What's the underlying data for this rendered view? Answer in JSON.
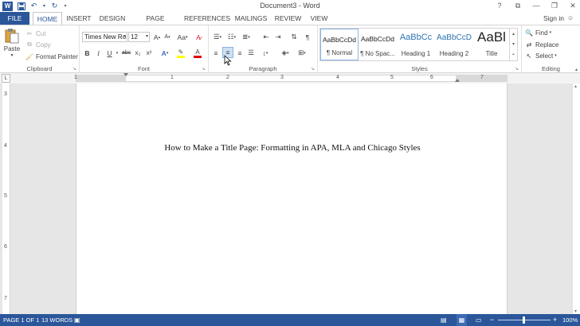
{
  "titlebar": {
    "app_icon": "W",
    "title": "Document3 - Word",
    "help": "?",
    "ribbon_display": "⧉",
    "minimize": "—",
    "restore": "❐",
    "close": "✕"
  },
  "tabs": {
    "file": "FILE",
    "items": [
      "HOME",
      "INSERT",
      "DESIGN",
      "PAGE LAYOUT",
      "REFERENCES",
      "MAILINGS",
      "REVIEW",
      "VIEW"
    ],
    "sign_in": "Sign in"
  },
  "clipboard": {
    "label": "Clipboard",
    "paste": "Paste",
    "cut": "Cut",
    "copy": "Copy",
    "format_painter": "Format Painter"
  },
  "font": {
    "label": "Font",
    "name": "Times New Ro",
    "size": "12",
    "grow": "A",
    "shrink": "A",
    "case": "Aa",
    "bold": "B",
    "italic": "I",
    "underline": "U",
    "strike": "abc",
    "subscript": "x₂",
    "superscript": "x²"
  },
  "paragraph": {
    "label": "Paragraph",
    "show_marks": "¶"
  },
  "styles": {
    "label": "Styles",
    "items": [
      {
        "preview": "AaBbCcDd",
        "name": "¶ Normal"
      },
      {
        "preview": "AaBbCcDd",
        "name": "¶ No Spac..."
      },
      {
        "preview": "AaBbCc",
        "name": "Heading 1"
      },
      {
        "preview": "AaBbCcD",
        "name": "Heading 2"
      },
      {
        "preview": "AaBl",
        "name": "Title"
      }
    ]
  },
  "editing": {
    "label": "Editing",
    "find": "Find",
    "replace": "Replace",
    "select": "Select"
  },
  "ruler": {
    "corner": "L",
    "h_numbers": [
      "1",
      "1",
      "2",
      "3",
      "4",
      "5",
      "6",
      "7"
    ],
    "v_numbers": [
      "3",
      "4",
      "5",
      "6",
      "7"
    ]
  },
  "document": {
    "text": "How to Make a Title Page: Formatting in APA, MLA and Chicago Styles"
  },
  "status": {
    "page": "PAGE 1 OF 1",
    "words": "13 WORDS",
    "zoom": "100%"
  },
  "colors": {
    "accent": "#2b579a",
    "highlight": "#ffff00",
    "font_color": "#e00000"
  }
}
